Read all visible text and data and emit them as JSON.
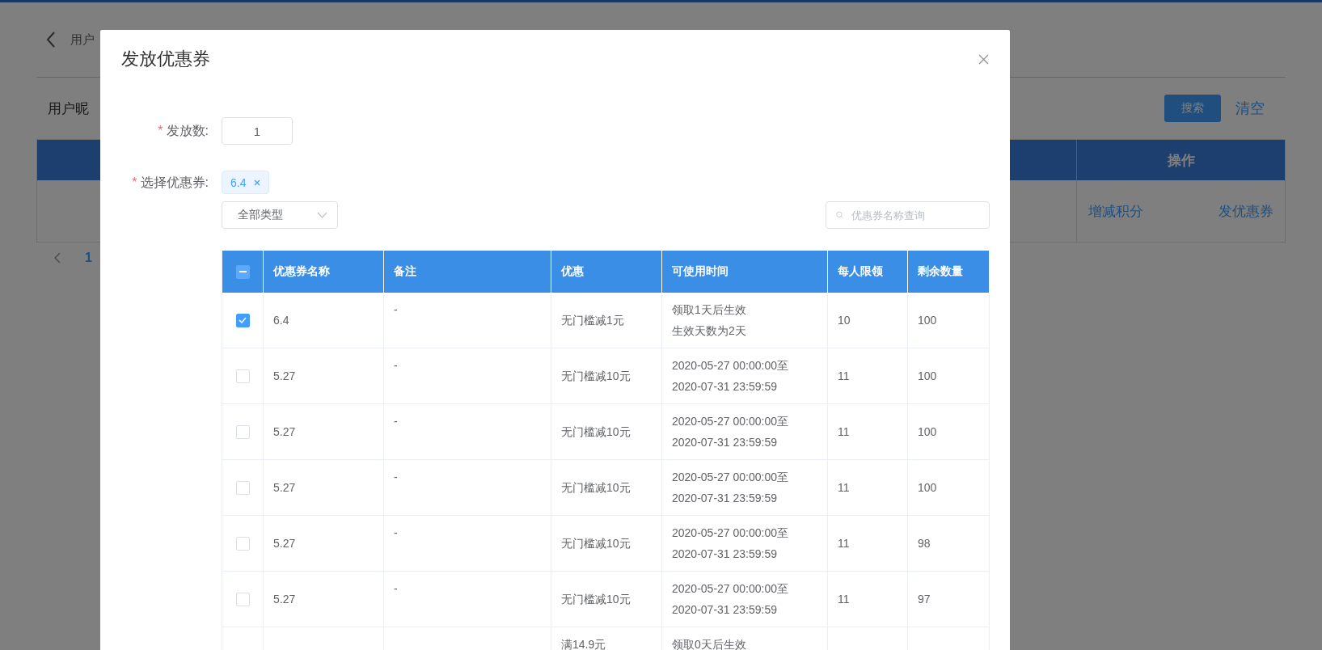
{
  "page": {
    "back_title": "用户",
    "filter_label": "用户昵",
    "search_button": "搜索",
    "clear_link": "清空",
    "table": {
      "action_header": "操作",
      "rows": [
        {
          "actions": [
            "增减积分",
            "发优惠券"
          ]
        }
      ]
    },
    "pagination": {
      "current": "1"
    }
  },
  "dialog": {
    "title": "发放优惠券",
    "quantity": {
      "required_mark": "*",
      "label": "发放数:",
      "value": "1"
    },
    "coupon": {
      "required_mark": "*",
      "label": "选择优惠券:",
      "tags": [
        {
          "label": "6.4"
        }
      ],
      "type_select": {
        "value": "全部类型"
      },
      "search": {
        "placeholder": "优惠券名称查询"
      }
    },
    "table": {
      "header_check": {
        "indeterminate": true
      },
      "columns": [
        "优惠券名称",
        "备注",
        "优惠",
        "可使用时间",
        "每人限领",
        "剩余数量"
      ],
      "rows": [
        {
          "checked": true,
          "name": "6.4",
          "note": "-",
          "discount": [
            "无门槛减1元"
          ],
          "time": [
            "领取1天后生效",
            "生效天数为2天"
          ],
          "limit": "10",
          "remain": "100"
        },
        {
          "checked": false,
          "name": "5.27",
          "note": "-",
          "discount": [
            "无门槛减10元"
          ],
          "time": [
            "2020-05-27 00:00:00至",
            "2020-07-31 23:59:59"
          ],
          "limit": "11",
          "remain": "100"
        },
        {
          "checked": false,
          "name": "5.27",
          "note": "-",
          "discount": [
            "无门槛减10元"
          ],
          "time": [
            "2020-05-27 00:00:00至",
            "2020-07-31 23:59:59"
          ],
          "limit": "11",
          "remain": "100"
        },
        {
          "checked": false,
          "name": "5.27",
          "note": "-",
          "discount": [
            "无门槛减10元"
          ],
          "time": [
            "2020-05-27 00:00:00至",
            "2020-07-31 23:59:59"
          ],
          "limit": "11",
          "remain": "100"
        },
        {
          "checked": false,
          "name": "5.27",
          "note": "-",
          "discount": [
            "无门槛减10元"
          ],
          "time": [
            "2020-05-27 00:00:00至",
            "2020-07-31 23:59:59"
          ],
          "limit": "11",
          "remain": "98"
        },
        {
          "checked": false,
          "name": "5.27",
          "note": "-",
          "discount": [
            "无门槛减10元"
          ],
          "time": [
            "2020-05-27 00:00:00至",
            "2020-07-31 23:59:59"
          ],
          "limit": "11",
          "remain": "97"
        },
        {
          "discount": [
            "满14.9元"
          ],
          "time": [
            "领取0天后生效"
          ]
        }
      ]
    }
  }
}
